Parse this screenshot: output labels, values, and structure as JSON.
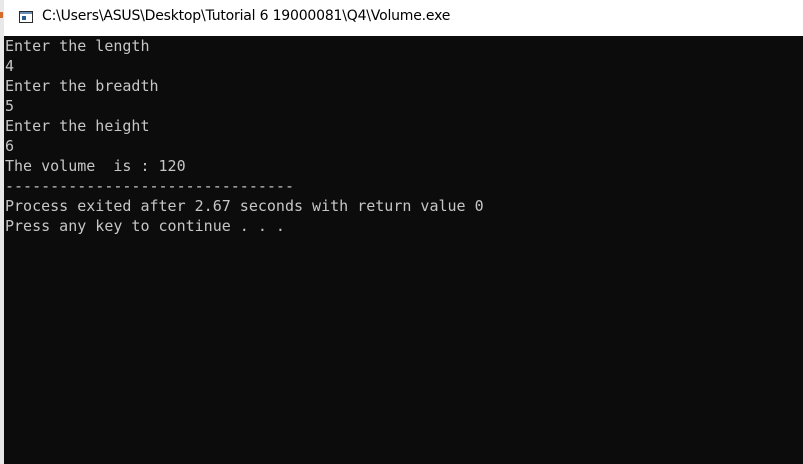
{
  "window": {
    "title": "C:\\Users\\ASUS\\Desktop\\Tutorial 6 19000081\\Q4\\Volume.exe",
    "icon": "console-app-icon"
  },
  "console": {
    "lines": [
      "Enter the length",
      "4",
      "Enter the breadth",
      "5",
      "Enter the height",
      "6",
      "The volume  is : 120",
      "--------------------------------",
      "Process exited after 2.67 seconds with return value 0",
      "Press any key to continue . . ."
    ]
  },
  "colors": {
    "console_background": "#0c0c0c",
    "console_text": "#c6c6c6",
    "titlebar_background": "#ffffff"
  }
}
